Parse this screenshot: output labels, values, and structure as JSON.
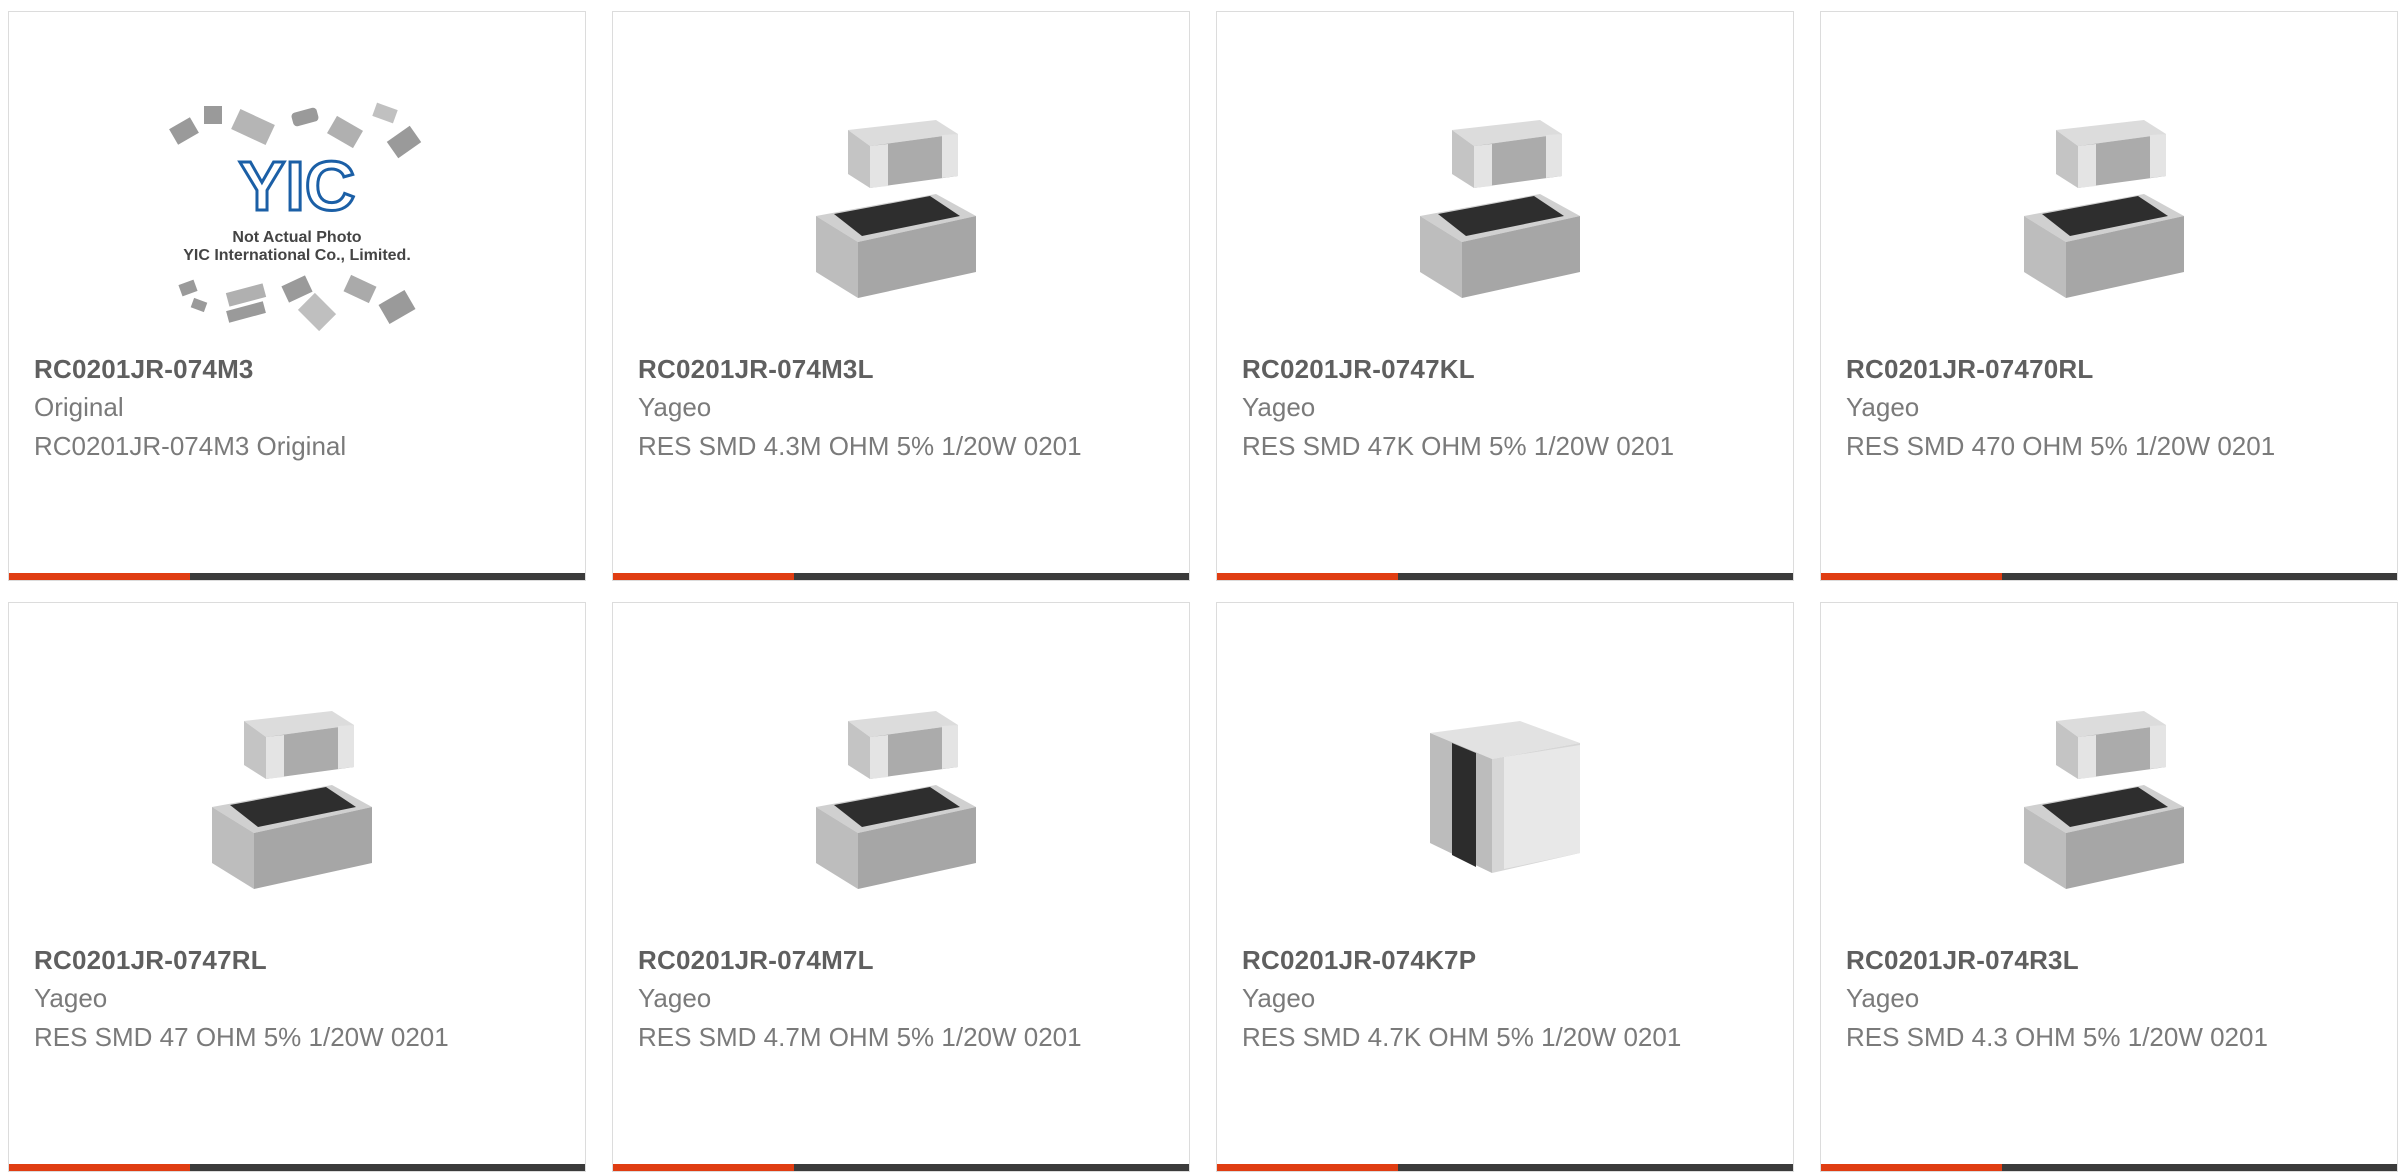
{
  "colors": {
    "accent": "#e03d12",
    "bar": "#3b3b3b",
    "title": "#5f5f5f",
    "text": "#7a7a7a",
    "logo_blue": "#1b5fa6"
  },
  "products": [
    {
      "part": "RC0201JR-074M3",
      "maker": "Original",
      "desc": "RC0201JR-074M3 Original",
      "image": "not-actual-photo-placeholder",
      "logo_text": "YIC",
      "placeholder_line1": "Not Actual Photo",
      "placeholder_line2": "YIC International Co., Limited."
    },
    {
      "part": "RC0201JR-074M3L",
      "maker": "Yageo",
      "desc": "RES SMD 4.3M OHM 5% 1/20W 0201",
      "image": "chip-resistor-photo"
    },
    {
      "part": "RC0201JR-0747KL",
      "maker": "Yageo",
      "desc": "RES SMD 47K OHM 5% 1/20W 0201",
      "image": "chip-resistor-photo"
    },
    {
      "part": "RC0201JR-07470RL",
      "maker": "Yageo",
      "desc": "RES SMD 470 OHM 5% 1/20W 0201",
      "image": "chip-resistor-photo"
    },
    {
      "part": "RC0201JR-0747RL",
      "maker": "Yageo",
      "desc": "RES SMD 47 OHM 5% 1/20W 0201",
      "image": "chip-resistor-photo"
    },
    {
      "part": "RC0201JR-074M7L",
      "maker": "Yageo",
      "desc": "RES SMD 4.7M OHM 5% 1/20W 0201",
      "image": "chip-resistor-photo"
    },
    {
      "part": "RC0201JR-074K7P",
      "maker": "Yageo",
      "desc": "RES SMD 4.7K OHM 5% 1/20W 0201",
      "image": "chip-resistor-angled-photo"
    },
    {
      "part": "RC0201JR-074R3L",
      "maker": "Yageo",
      "desc": "RES SMD 4.3 OHM 5% 1/20W 0201",
      "image": "chip-resistor-photo"
    }
  ]
}
